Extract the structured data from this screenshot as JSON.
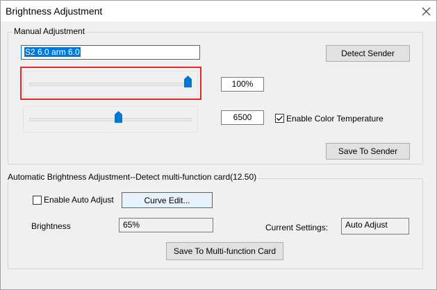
{
  "window": {
    "title": "Brightness Adjustment",
    "close_icon": "close-icon"
  },
  "manual": {
    "group_label": "Manual Adjustment",
    "sender_text": "S2 6.0 arm 6.0",
    "detect_sender_label": "Detect Sender",
    "brightness_value": "100%",
    "brightness_level_percent": 100,
    "color_temp_value": "6500",
    "color_temp_level_percent": 55,
    "enable_color_temp_label": "Enable Color Temperature",
    "enable_color_temp_checked": true,
    "save_to_sender_label": "Save To Sender"
  },
  "auto": {
    "group_label": "Automatic Brightness Adjustment--Detect multi-function card(12.50)",
    "enable_auto_adjust_label": "Enable Auto Adjust",
    "enable_auto_adjust_checked": false,
    "curve_edit_label": "Curve Edit...",
    "brightness_label": "Brightness",
    "brightness_value": "65%",
    "current_settings_label": "Current Settings:",
    "current_settings_value": "Auto Adjust",
    "save_to_card_label": "Save To Multi-function Card"
  },
  "colors": {
    "accent": "#0078d7",
    "highlight": "#e8262a",
    "thumb": "#0078d7"
  }
}
